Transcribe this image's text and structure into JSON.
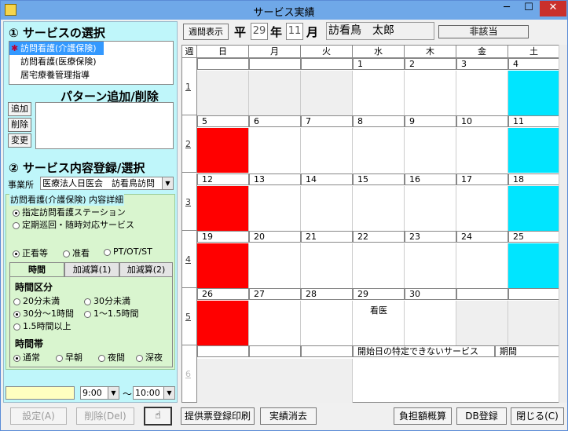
{
  "window": {
    "title": "サービス実績",
    "min_glyph": "─",
    "max_glyph": "☐",
    "close_glyph": "✕"
  },
  "left": {
    "service_select_title": "① サービスの選択",
    "services": [
      "訪問看護(介護保険)",
      "訪問看護(医療保険)",
      "居宅療養管理指導"
    ],
    "pattern_title": "パターン追加/削除",
    "pattern_buttons": [
      "追加",
      "削除",
      "変更"
    ],
    "content_title": "② サービス内容登録/選択",
    "jigyosho_label": "事業所",
    "jigyosho_value": "医療法人日医会　訪看鳥訪問",
    "detail_legend": "訪問看護(介護保険) 内容詳細",
    "station_options": [
      "指定訪問看護ステーション",
      "定期巡回・随時対応サービス"
    ],
    "staff_options": [
      "正看等",
      "准看",
      "PT/OT/ST"
    ],
    "tabs": [
      "時間",
      "加減算(1)",
      "加減算(2)"
    ],
    "time_group_title": "時間区分",
    "time_options": [
      "20分未満",
      "30分未満",
      "30分～1時間",
      "1～1.5時間",
      "1.5時間以上"
    ],
    "period_group_title": "時間帯",
    "period_options": [
      "通常",
      "早朝",
      "夜間",
      "深夜"
    ],
    "time_from": "9:00",
    "time_to": "10:00",
    "tilde": "～"
  },
  "header": {
    "week_button": "週間表示",
    "era": "平",
    "year": "29",
    "year_unit": "年",
    "month": "11",
    "month_unit": "月",
    "patient_name": "訪看鳥　太郎",
    "status": "非該当"
  },
  "calendar": {
    "week_label": "週",
    "days": [
      "日",
      "月",
      "火",
      "水",
      "木",
      "金",
      "土"
    ],
    "weeks": [
      {
        "num": "1",
        "dates": [
          "",
          "",
          "",
          "1",
          "2",
          "3",
          "4"
        ]
      },
      {
        "num": "2",
        "dates": [
          "5",
          "6",
          "7",
          "8",
          "9",
          "10",
          "11"
        ]
      },
      {
        "num": "3",
        "dates": [
          "12",
          "13",
          "14",
          "15",
          "16",
          "17",
          "18"
        ]
      },
      {
        "num": "4",
        "dates": [
          "19",
          "20",
          "21",
          "22",
          "23",
          "24",
          "25"
        ]
      },
      {
        "num": "5",
        "dates": [
          "26",
          "27",
          "28",
          "29",
          "30",
          "",
          ""
        ]
      },
      {
        "num": "6",
        "dates": [
          "",
          "",
          "",
          "",
          "",
          "",
          ""
        ]
      }
    ],
    "note_kango": "看医",
    "unspecified_label": "開始日の特定できないサービス",
    "period_label": "期間",
    "colors": {
      "sunday": "#ff0000",
      "saturday": "#00e5ff",
      "inactive": "#efefef"
    }
  },
  "buttons": {
    "settei": "設定(A)",
    "sakujo": "削除(Del)",
    "hand_glyph": "☝",
    "print": "提供票登録印刷",
    "clear": "実績消去",
    "burden": "負担額概算",
    "db": "DB登録",
    "close": "閉じる(C)"
  }
}
